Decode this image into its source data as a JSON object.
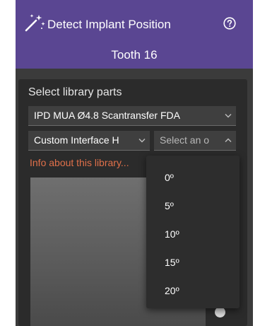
{
  "header": {
    "title": "Detect Implant Position",
    "subtitle": "Tooth 16",
    "background": "#5a4692",
    "icons": [
      "magic-wand-icon",
      "help-icon"
    ]
  },
  "library": {
    "section_label": "Select library parts",
    "library_select_value": "IPD MUA Ø4.8 Scantransfer FDA",
    "interface_select_value": "Custom Interface H",
    "angle_select_placeholder": "Select an o",
    "info_link": "Info about this library...",
    "info_link_color": "#e0704a"
  },
  "dropdown": {
    "options": [
      "0º",
      "5º",
      "10º",
      "15º",
      "20º"
    ]
  }
}
